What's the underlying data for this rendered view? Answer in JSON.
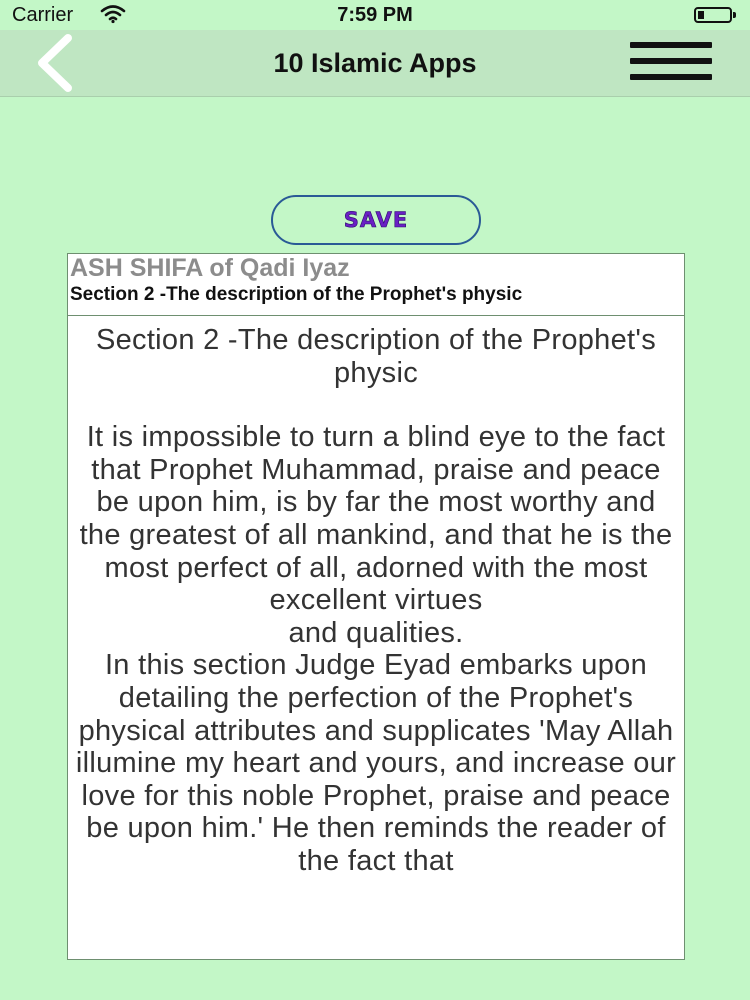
{
  "status_bar": {
    "carrier": "Carrier",
    "time": "7:59 PM",
    "icons": [
      "wifi-icon",
      "battery-icon"
    ]
  },
  "nav_bar": {
    "title": "10 Islamic Apps",
    "back_icon": "chevron-left-icon",
    "menu_icon": "hamburger-menu-icon"
  },
  "save_button": {
    "label": "SAVE"
  },
  "book": {
    "title": "ASH SHIFA of Qadi Iyaz",
    "section_subtitle": "Section 2 -The description of the Prophet's physic"
  },
  "content": {
    "heading": "Section 2 -The description of the Prophet's physic",
    "paragraph_1": "It is impossible to turn a blind eye to the fact that Prophet Muhammad, praise and peace be upon him, is by far the most worthy and the greatest of all mankind, and that he is the most perfect of all, adorned with the most excellent virtues",
    "paragraph_1_tail": "and qualities.",
    "paragraph_2": "In this section Judge Eyad embarks upon detailing the perfection of the Prophet's physical attributes and supplicates 'May Allah illumine my heart and yours, and increase our love for this noble Prophet, praise and peace be upon him.' He then reminds the reader of the fact that"
  },
  "colors": {
    "background": "#c3f7c7",
    "nav_bar": "#bfe6c2",
    "save_border": "#2a5a96",
    "save_text": "#6a1fc4",
    "content_text": "#333333"
  }
}
